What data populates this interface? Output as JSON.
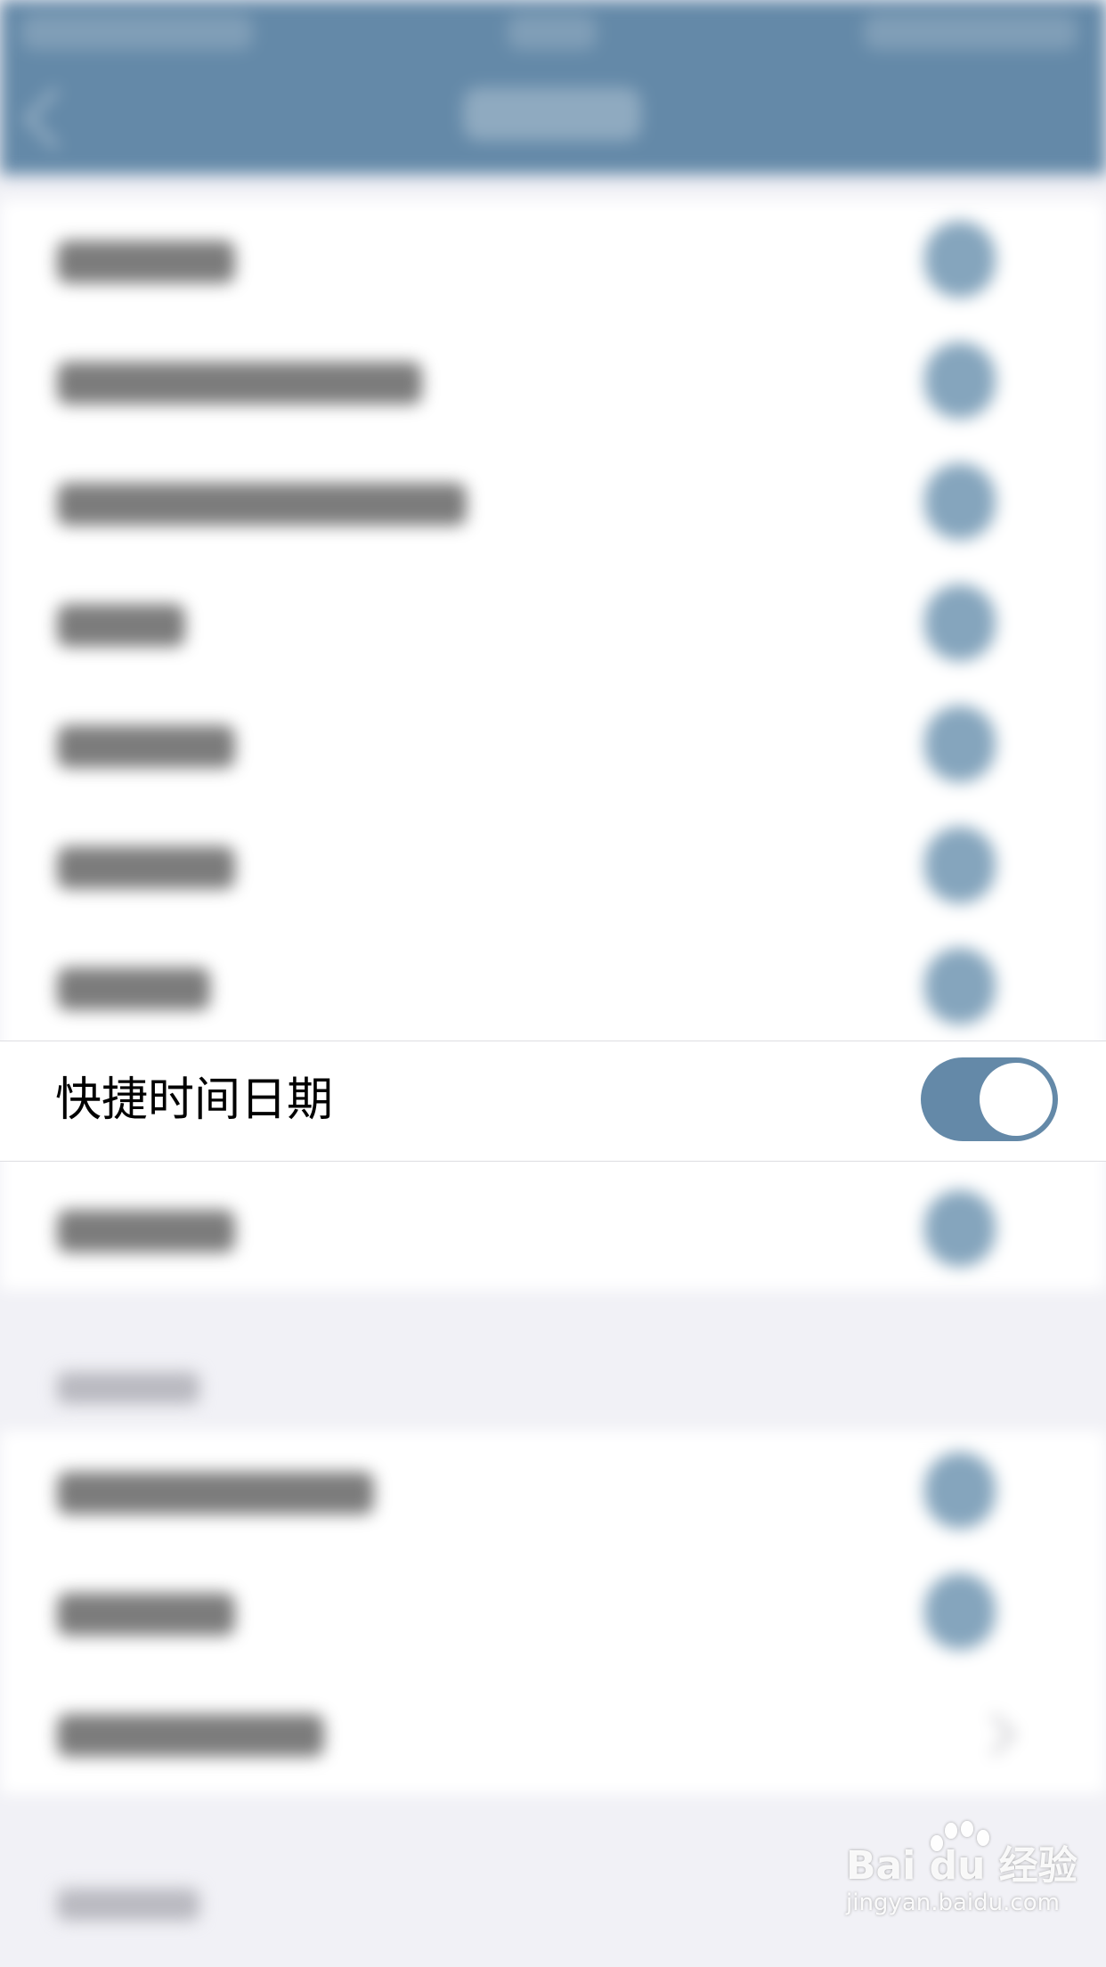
{
  "settings": {
    "highlighted_row": {
      "label": "快捷时间日期",
      "enabled": true
    }
  },
  "watermark": {
    "logo": "Bai du 经验",
    "url": "jingyan.baidu.com"
  },
  "colors": {
    "accent": "#6489a8",
    "background": "#f1f1f6",
    "row_background": "#ffffff"
  }
}
